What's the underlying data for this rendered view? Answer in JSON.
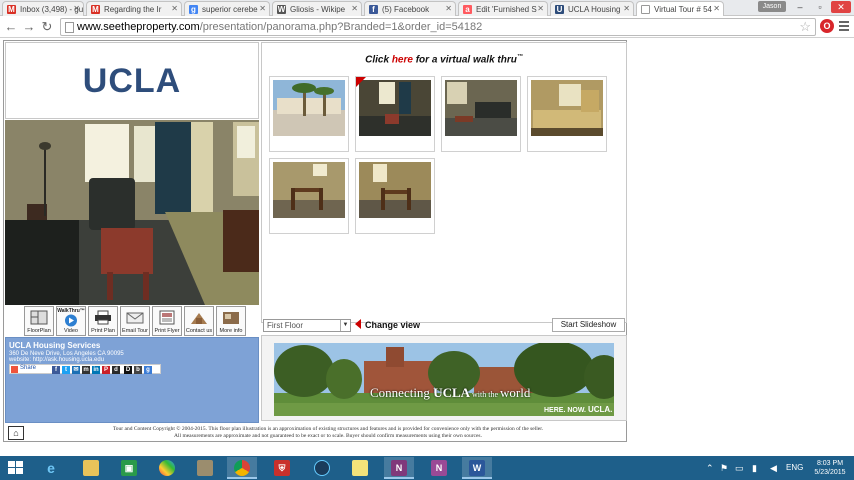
{
  "browser": {
    "tabs": [
      {
        "label": "Inbox (3,498) - gu",
        "favicon": "gmail-icon",
        "fav_text": "M",
        "fav_color": "#d93025",
        "active": false
      },
      {
        "label": "Regarding the Ir",
        "favicon": "gmail-icon",
        "fav_text": "M",
        "fav_color": "#d93025",
        "active": false
      },
      {
        "label": "superior cerebe",
        "favicon": "google-icon",
        "fav_text": "g",
        "fav_color": "#4285f4",
        "active": false
      },
      {
        "label": "Gliosis - Wikipe",
        "favicon": "wikipedia-icon",
        "fav_text": "W",
        "fav_color": "#555555",
        "active": false
      },
      {
        "label": "(5) Facebook",
        "favicon": "facebook-icon",
        "fav_text": "f",
        "fav_color": "#3b5998",
        "active": false
      },
      {
        "label": "Edit 'Furnished S",
        "favicon": "airbnb-icon",
        "fav_text": "a",
        "fav_color": "#ff5a5f",
        "active": false
      },
      {
        "label": "UCLA Housing",
        "favicon": "ucla-icon",
        "fav_text": "U",
        "fav_color": "#2e4d7b",
        "active": false
      },
      {
        "label": "Virtual Tour # 54",
        "favicon": "page-icon",
        "fav_text": "",
        "fav_color": "#ffffff",
        "active": true
      }
    ],
    "user_label": "Jason",
    "url_domain": "www.seetheproperty.com",
    "url_path": "/presentation/panorama.php?Branded=1&order_id=54182"
  },
  "property": {
    "logo_text": "UCLA",
    "headline_prefix": "Click ",
    "headline_link": "here",
    "headline_suffix": " for a virtual walk thru",
    "headline_tm": "™",
    "tools": [
      {
        "label": "FloorPlan",
        "icon": "floorplan-icon"
      },
      {
        "label": "Video",
        "icon": "video-icon",
        "badge": "WalkThru™"
      },
      {
        "label": "Print Plan",
        "icon": "printer-icon"
      },
      {
        "label": "Email Tour",
        "icon": "email-icon"
      },
      {
        "label": "Print Flyer",
        "icon": "flyer-icon"
      },
      {
        "label": "Contact us",
        "icon": "contact-icon"
      },
      {
        "label": "More info",
        "icon": "info-icon"
      }
    ],
    "org_name": "UCLA Housing Services",
    "address": "360 De Neve Drive, Los Angeles CA 90095",
    "website": "website: http://ask.housing.ucla.edu",
    "share_label": "Share",
    "floor_select_value": "First Floor",
    "change_view_label": "Change view",
    "slideshow_label": "Start Slideshow",
    "banner_tagline_a": "Connecting ",
    "banner_tagline_b": "UCLA",
    "banner_tagline_c": " with the ",
    "banner_tagline_d": "world",
    "banner_sub_a": "HERE. NOW. ",
    "banner_sub_b": "UCLA.",
    "footer_line1": "Tour and Content Copyright © 2004-2015. This floor plan illustration is an approximation of existing structures and features and is provided for convenience only with the permission of the seller.",
    "footer_line2": "All measurements are approximate and not guaranteed to be exact or to scale. Buyer should confirm measurements using their own sources."
  },
  "taskbar": {
    "lang": "ENG",
    "time": "8:03 PM",
    "date": "5/23/2015"
  }
}
